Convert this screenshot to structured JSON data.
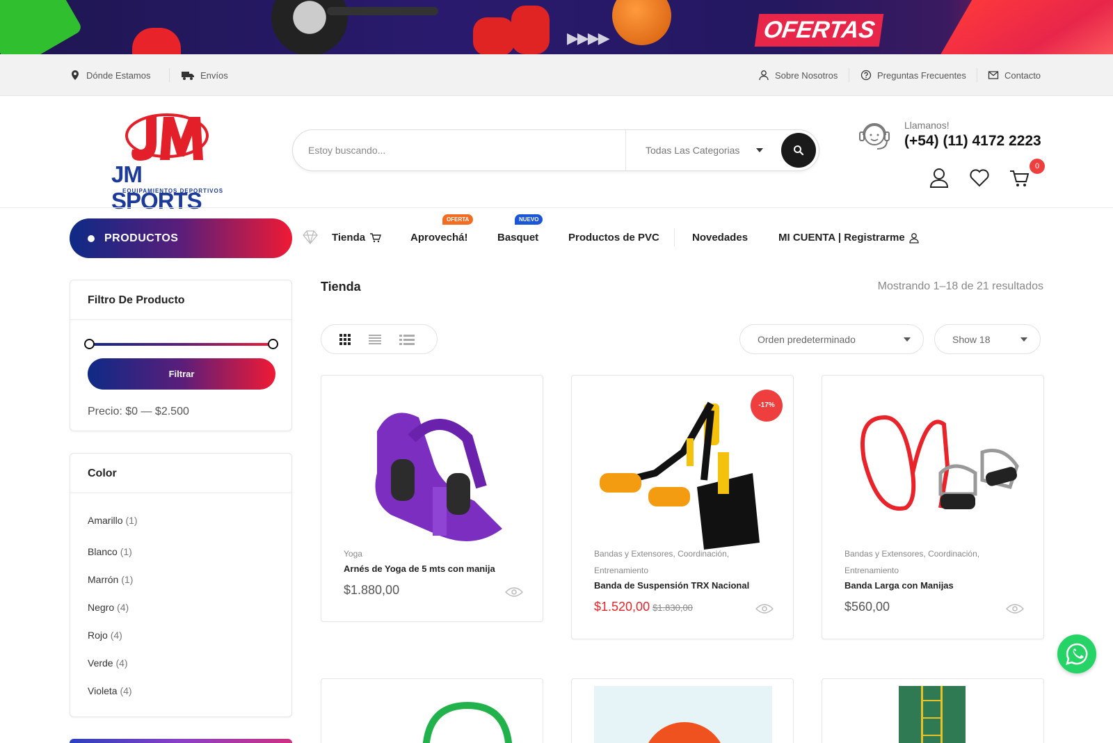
{
  "banner": {
    "headline": "OFERTAS",
    "colors": {
      "background": "#241860",
      "accent": "#e8264a"
    }
  },
  "topbar": {
    "left": [
      {
        "label": "Dónde Estamos",
        "icon": "map-pin-icon"
      },
      {
        "label": "Envíos",
        "icon": "truck-icon"
      }
    ],
    "right": [
      {
        "label": "Sobre Nosotros",
        "icon": "user-icon"
      },
      {
        "label": "Preguntas Frecuentes",
        "icon": "question-circle-icon"
      },
      {
        "label": "Contacto",
        "icon": "envelope-icon"
      }
    ]
  },
  "header": {
    "logo": {
      "brand": "JM SPORTS",
      "subtitle": "EQUIPAMIENTOS DEPORTIVOS"
    },
    "search": {
      "placeholder": "Estoy buscando...",
      "category": "Todas Las Categorias"
    },
    "call": {
      "label": "Llamanos!",
      "number": "(+54) (11) 4172 2223"
    },
    "cart_count": "0"
  },
  "nav": {
    "products_button": "PRODUCTOS",
    "items": [
      {
        "label": "Tienda",
        "icon": "cart-icon"
      },
      {
        "label": "Aprovechá!",
        "tag": "OFERTA"
      },
      {
        "label": "Basquet",
        "tag": "NUEVO"
      },
      {
        "label": "Productos de PVC"
      },
      {
        "label": "Novedades"
      },
      {
        "label": "MI CUENTA | Registrarme",
        "icon": "user-icon"
      }
    ],
    "tag_colors": {
      "oferta": "#f26d21",
      "nuevo": "#1a56d6"
    }
  },
  "sidebar": {
    "filter": {
      "title": "Filtro De Producto",
      "button": "Filtrar",
      "price": "Precio: $0 — $2.500"
    },
    "colors": {
      "title": "Color",
      "items": [
        {
          "label": "Amarillo",
          "count": "(1)"
        },
        {
          "label": "Blanco",
          "count": "(1)"
        },
        {
          "label": "Marrón",
          "count": "(1)"
        },
        {
          "label": "Negro",
          "count": "(4)"
        },
        {
          "label": "Rojo",
          "count": "(4)"
        },
        {
          "label": "Verde",
          "count": "(4)"
        },
        {
          "label": "Violeta",
          "count": "(4)"
        }
      ]
    }
  },
  "main": {
    "title": "Tienda",
    "results": "Mostrando 1–18 de 21 resultados",
    "sort": "Orden predeterminado",
    "show": "Show 18",
    "products": [
      {
        "category": "Yoga",
        "name": "Arnés de Yoga de 5 mts con manija",
        "price": "$1.880,00"
      },
      {
        "category": "Bandas y Extensores, Coordinación, Entrenamiento",
        "name": "Banda de Suspensión TRX Nacional",
        "price": "$1.520,00",
        "old_price": "$1.830,00",
        "discount": "-17%"
      },
      {
        "category": "Bandas y Extensores, Coordinación, Entrenamiento",
        "name": "Banda Larga con Manijas",
        "price": "$560,00"
      }
    ]
  }
}
